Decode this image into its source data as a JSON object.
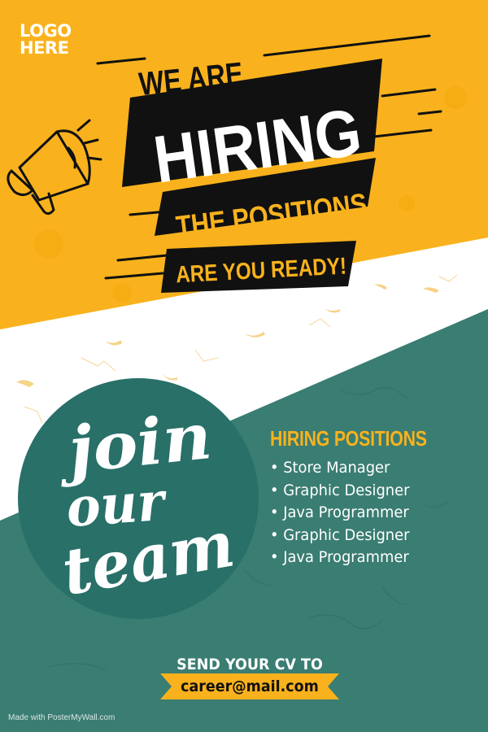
{
  "logo": {
    "line1": "LOGO",
    "line2": "HERE"
  },
  "headline": {
    "we_are": "WE ARE",
    "hiring": "HIRING",
    "the_positions": "THE POSITIONS",
    "are_you_ready": "ARE YOU READY!"
  },
  "circle_text": {
    "line1": "join",
    "line2": "our",
    "line3": "team"
  },
  "positions": {
    "title": "HIRING POSITIONS",
    "items": [
      "Store Manager",
      "Graphic Designer",
      "Java Programmer",
      "Graphic Designer",
      "Java Programmer"
    ]
  },
  "contact": {
    "label": "SEND YOUR CV TO",
    "email": "career@mail.com"
  },
  "credit": "Made with PosterMyWall.com",
  "colors": {
    "yellow": "#f9b21d",
    "teal": "#3a7d72",
    "teal_dark": "#287068",
    "black": "#111111",
    "white": "#ffffff"
  },
  "icons": [
    "megaphone-icon"
  ]
}
